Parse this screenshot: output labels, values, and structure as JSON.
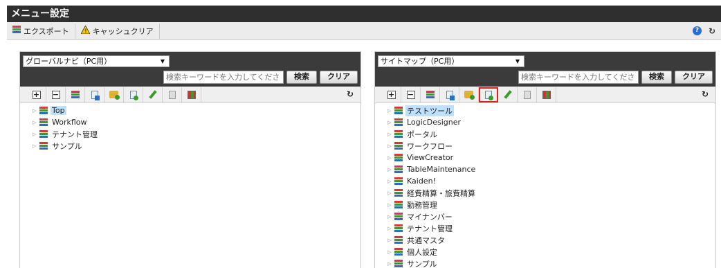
{
  "title": "メニュー設定",
  "toolbar": {
    "export_label": "エクスポート",
    "clear_cache_label": "キャッシュクリア"
  },
  "colors": {
    "menu_icon": [
      "#d43a3a",
      "#3a9a2a",
      "#2a6ec4"
    ],
    "selected_bg": "#bfe0fb",
    "highlight_border": "#e12020"
  },
  "left_pane": {
    "select_value": "グローバルナビ（PC用）",
    "search_placeholder": "検索キーワードを入力してくださ",
    "search_button": "検索",
    "clear_button": "クリア",
    "tree": [
      {
        "label": "Top",
        "selected": true
      },
      {
        "label": "Workflow"
      },
      {
        "label": "テナント管理"
      },
      {
        "label": "サンプル"
      }
    ]
  },
  "right_pane": {
    "select_value": "サイトマップ（PC用）",
    "search_placeholder": "検索キーワードを入力してくださ",
    "search_button": "検索",
    "clear_button": "クリア",
    "tree": [
      {
        "label": "テストツール",
        "selected": true
      },
      {
        "label": "LogicDesigner"
      },
      {
        "label": "ポータル"
      },
      {
        "label": "ワークフロー"
      },
      {
        "label": "ViewCreator"
      },
      {
        "label": "TableMaintenance"
      },
      {
        "label": "Kaiden!"
      },
      {
        "label": "経費精算・旅費精算"
      },
      {
        "label": "勤務管理"
      },
      {
        "label": "マイナンバー"
      },
      {
        "label": "テナント管理"
      },
      {
        "label": "共通マスタ"
      },
      {
        "label": "個人設定"
      },
      {
        "label": "サンプル"
      }
    ]
  },
  "tree_toolbar_icons": [
    "expand-all-icon",
    "collapse-all-icon",
    "add-menu-icon",
    "add-page-icon",
    "add-folder-icon",
    "add-link-icon",
    "edit-pencil-icon",
    "delete-trash-icon",
    "grid-icon"
  ]
}
